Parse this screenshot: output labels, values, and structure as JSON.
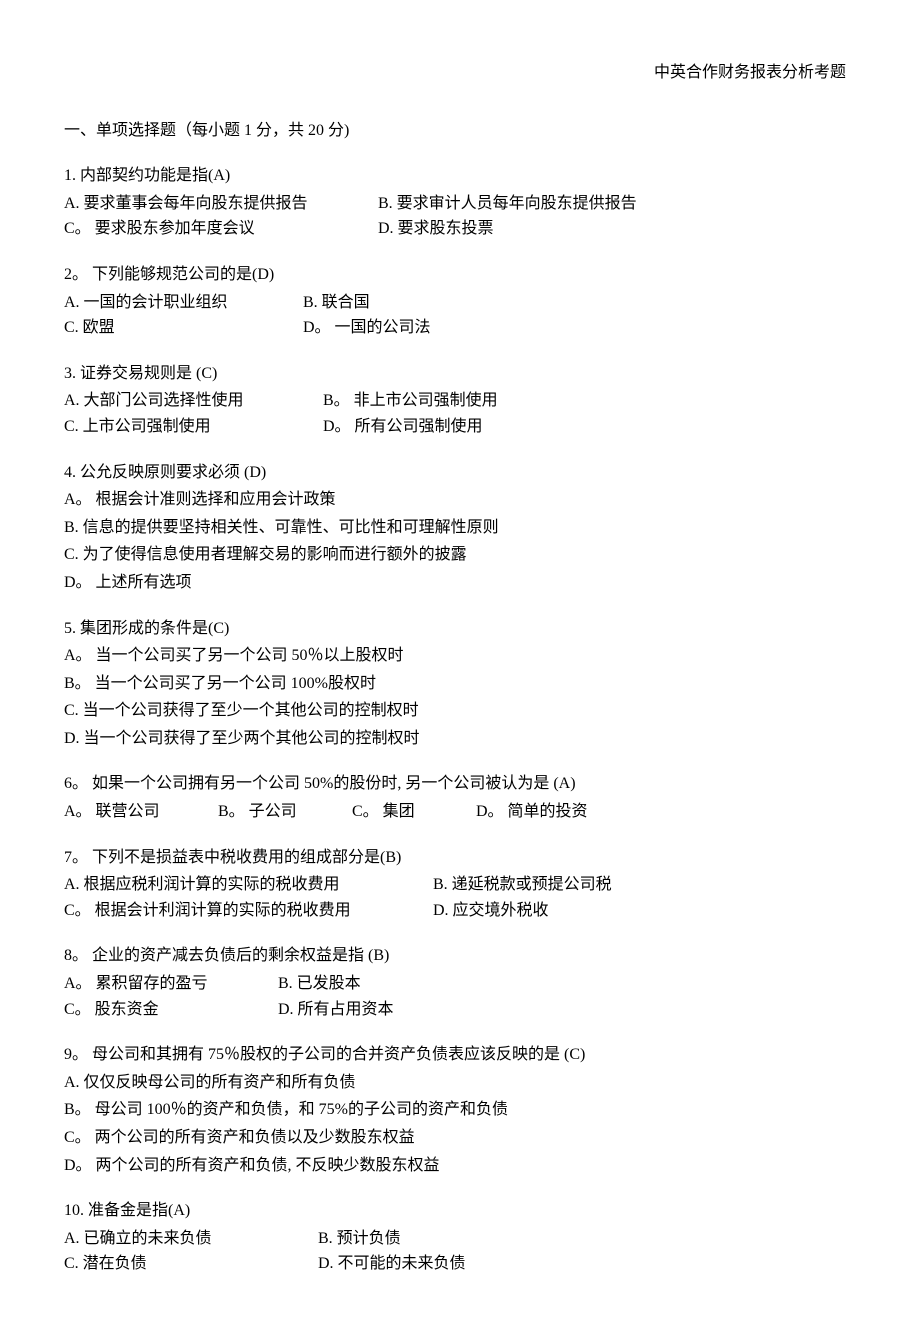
{
  "header": {
    "title": "中英合作财务报表分析考题"
  },
  "section": {
    "title": "一、单项选择题（每小题 1 分，共 20 分)"
  },
  "questions": {
    "q1": {
      "stem": "1.  内部契约功能是指(A)",
      "optA": "A.  要求董事会每年向股东提供报告",
      "optB": "B.  要求审计人员每年向股东提供报告",
      "optC": "C。 要求股东参加年度会议",
      "optD": "D.  要求股东投票"
    },
    "q2": {
      "stem": "2。 下列能够规范公司的是(D)",
      "optA": "A.  一国的会计职业组织",
      "optB": "B.  联合国",
      "optC": "C.  欧盟",
      "optD": "D。 一国的公司法"
    },
    "q3": {
      "stem": "3.  证券交易规则是  (C)",
      "optA": "A.  大部门公司选择性使用",
      "optB": "B。 非上市公司强制使用",
      "optC": "C.  上市公司强制使用",
      "optD": "D。 所有公司强制使用"
    },
    "q4": {
      "stem": "4.  公允反映原则要求必须  (D)",
      "optA": "A。 根据会计准则选择和应用会计政策",
      "optB": "B.  信息的提供要坚持相关性、可靠性、可比性和可理解性原则",
      "optC": "C.  为了使得信息使用者理解交易的影响而进行额外的披露",
      "optD": "D。 上述所有选项"
    },
    "q5": {
      "stem": "5.  集团形成的条件是(C)",
      "optA": "A。 当一个公司买了另一个公司 50％以上股权时",
      "optB": "B。 当一个公司买了另一个公司 100%股权时",
      "optC": "C.  当一个公司获得了至少一个其他公司的控制权时",
      "optD": "D.  当一个公司获得了至少两个其他公司的控制权时"
    },
    "q6": {
      "stem": "6。 如果一个公司拥有另一个公司 50%的股份时, 另一个公司被认为是  (A)",
      "optA": "A。 联营公司",
      "optB": "B。 子公司",
      "optC": "C。 集团",
      "optD": "D。 简单的投资"
    },
    "q7": {
      "stem": "7。 下列不是损益表中税收费用的组成部分是(B)",
      "optA": "A.  根据应税利润计算的实际的税收费用",
      "optB": "B.  递延税款或预提公司税",
      "optC": "C。 根据会计利润计算的实际的税收费用",
      "optD": "D.  应交境外税收"
    },
    "q8": {
      "stem": "8。 企业的资产减去负债后的剩余权益是指  (B)",
      "optA": "A。 累积留存的盈亏",
      "optB": "B.  已发股本",
      "optC": "C。 股东资金",
      "optD": "D.  所有占用资本"
    },
    "q9": {
      "stem": "9。 母公司和其拥有 75％股权的子公司的合并资产负债表应该反映的是  (C)",
      "optA": "A.  仅仅反映母公司的所有资产和所有负债",
      "optB": "B。 母公司 100％的资产和负债，和 75%的子公司的资产和负债",
      "optC": "C。 两个公司的所有资产和负债以及少数股东权益",
      "optD": "D。 两个公司的所有资产和负债, 不反映少数股东权益"
    },
    "q10": {
      "stem": "10.  准备金是指(A)",
      "optA": "A.  已确立的未来负债",
      "optB": "B.  预计负债",
      "optC": "C.  潜在负债",
      "optD": "D.  不可能的未来负债"
    }
  }
}
